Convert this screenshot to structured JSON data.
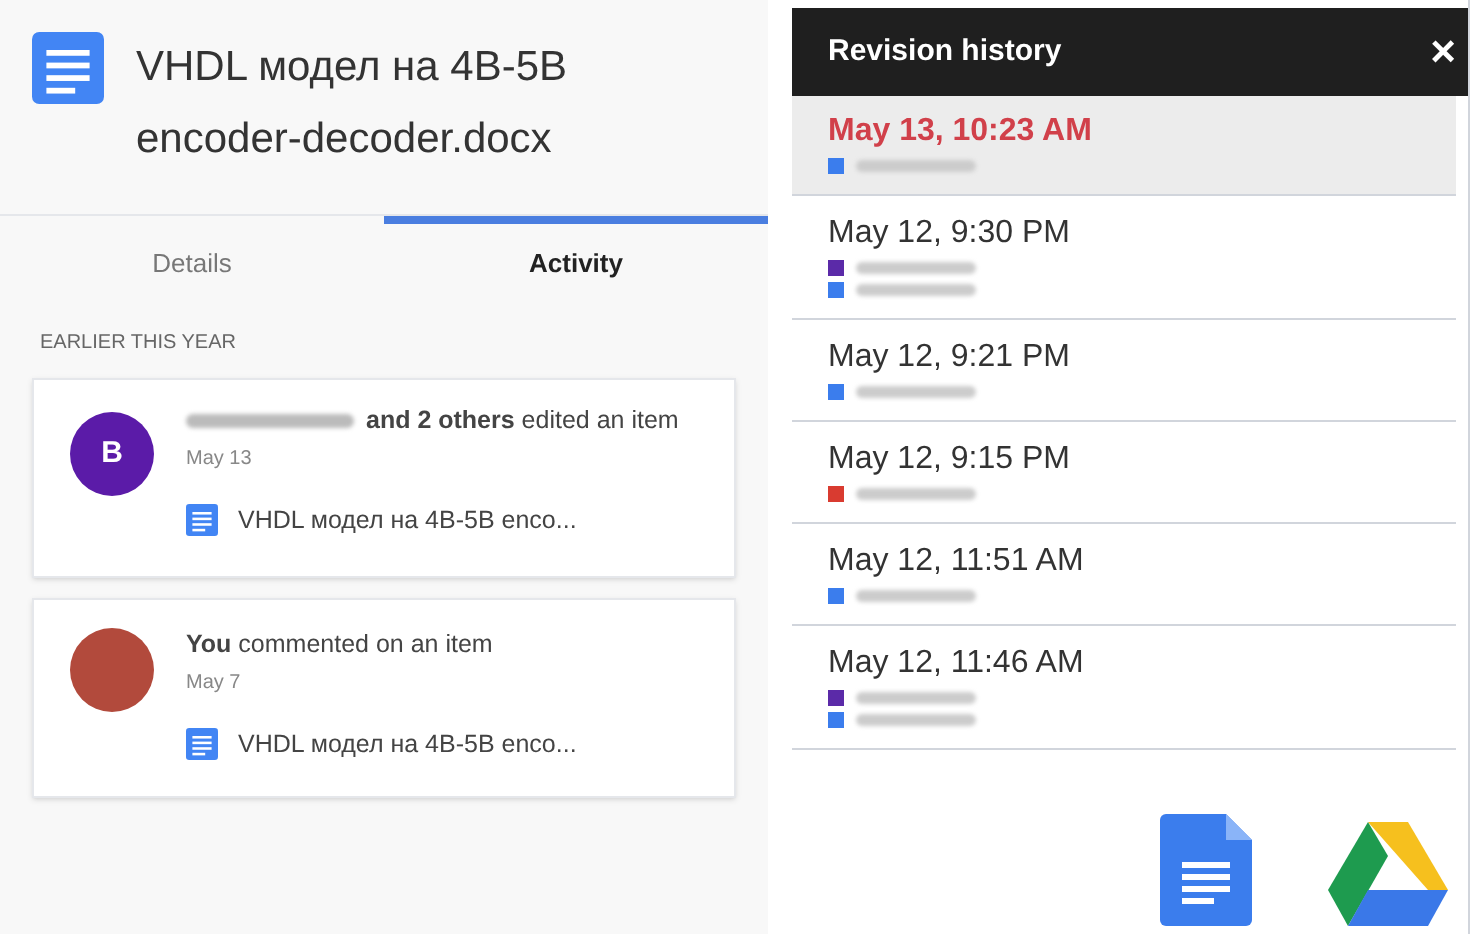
{
  "file": {
    "title_line_1": "VHDL модел на 4B-5B",
    "title_line_2": "encoder-decoder.docx"
  },
  "tabs": [
    {
      "label": "Details",
      "selected": false
    },
    {
      "label": "Activity",
      "selected": true
    }
  ],
  "section_heading": "EARLIER THIS YEAR",
  "activity": [
    {
      "avatar": {
        "kind": "letter",
        "letter": "B",
        "color": "#5b1ba8"
      },
      "name_blurred": true,
      "summary": "**and 2 others** edited an item",
      "date": "May 13",
      "file_name": "VHDL модел на 4B-5B enco..."
    },
    {
      "avatar": {
        "kind": "photo"
      },
      "name_blurred": false,
      "summary": "**You** commented on an item",
      "date": "May 7",
      "file_name": "VHDL модел на 4B-5B enco..."
    }
  ],
  "revision_history": {
    "title": "Revision history",
    "close": "×",
    "revisions": [
      {
        "time": "May 13, 10:23 AM",
        "selected": true,
        "authors": [
          {
            "color": "#3b7ded"
          }
        ]
      },
      {
        "time": "May 12, 9:30 PM",
        "selected": false,
        "authors": [
          {
            "color": "#5b2aa8"
          },
          {
            "color": "#3b7ded"
          }
        ]
      },
      {
        "time": "May 12, 9:21 PM",
        "selected": false,
        "authors": [
          {
            "color": "#3b7ded"
          }
        ]
      },
      {
        "time": "May 12, 9:15 PM",
        "selected": false,
        "authors": [
          {
            "color": "#d93b30"
          }
        ]
      },
      {
        "time": "May 12, 11:51 AM",
        "selected": false,
        "authors": [
          {
            "color": "#3b7ded"
          }
        ]
      },
      {
        "time": "May 12, 11:46 AM",
        "selected": false,
        "authors": [
          {
            "color": "#5b2aa8"
          },
          {
            "color": "#3b7ded"
          }
        ]
      }
    ]
  }
}
